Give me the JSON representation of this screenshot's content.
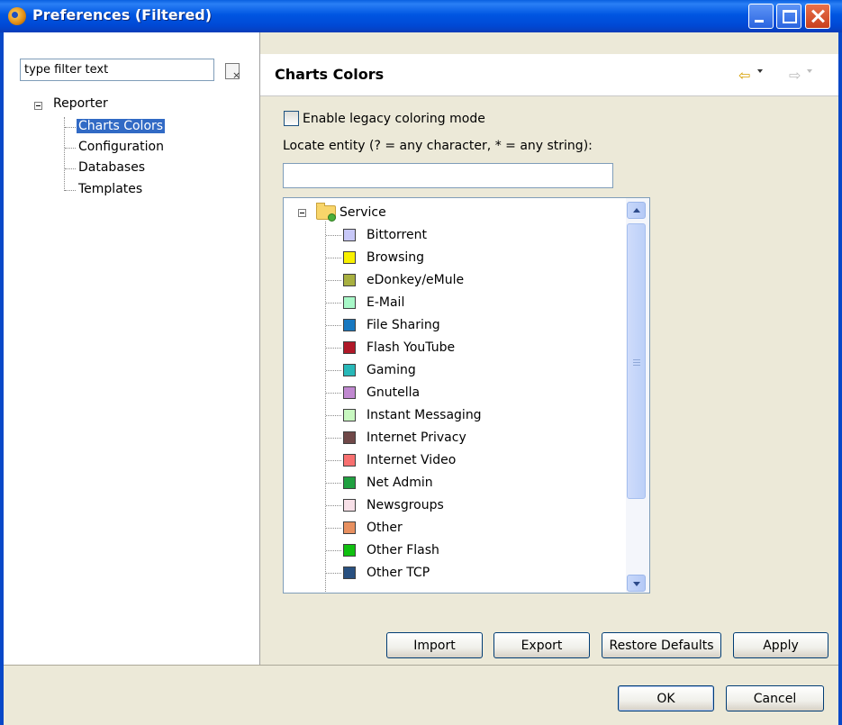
{
  "window": {
    "title": "Preferences (Filtered)"
  },
  "filter": {
    "value": "type filter text"
  },
  "tree": {
    "root": "Reporter",
    "children": [
      "Charts Colors",
      "Configuration",
      "Databases",
      "Templates"
    ],
    "selected": "Charts Colors"
  },
  "page": {
    "title": "Charts Colors",
    "checkbox_label": "Enable legacy coloring mode",
    "checkbox_checked": false,
    "locate_label": "Locate entity (? = any character, * = any string):",
    "locate_value": ""
  },
  "entities": {
    "group": "Service",
    "items": [
      {
        "name": "Bittorrent",
        "color": "#c8c8f8"
      },
      {
        "name": "Browsing",
        "color": "#f8f000"
      },
      {
        "name": "eDonkey/eMule",
        "color": "#a8b040"
      },
      {
        "name": "E-Mail",
        "color": "#a8f8c8"
      },
      {
        "name": "File Sharing",
        "color": "#1878c0"
      },
      {
        "name": "Flash YouTube",
        "color": "#b01828"
      },
      {
        "name": "Gaming",
        "color": "#28b8b8"
      },
      {
        "name": "Gnutella",
        "color": "#c088d0"
      },
      {
        "name": "Instant Messaging",
        "color": "#c8f8c0"
      },
      {
        "name": "Internet Privacy",
        "color": "#704848"
      },
      {
        "name": "Internet Video",
        "color": "#f87070"
      },
      {
        "name": "Net Admin",
        "color": "#20a040"
      },
      {
        "name": "Newsgroups",
        "color": "#f8e0e8"
      },
      {
        "name": "Other",
        "color": "#e89060"
      },
      {
        "name": "Other Flash",
        "color": "#10c010"
      },
      {
        "name": "Other TCP",
        "color": "#285080"
      }
    ]
  },
  "buttons": {
    "import": "Import",
    "export": "Export",
    "restore": "Restore Defaults",
    "apply": "Apply",
    "ok": "OK",
    "cancel": "Cancel"
  },
  "icons": {
    "app": "eclipse-app-icon",
    "clear": "clear-filter-icon",
    "back": "back-arrow-icon",
    "forward": "forward-arrow-icon",
    "folder": "folder-icon"
  }
}
